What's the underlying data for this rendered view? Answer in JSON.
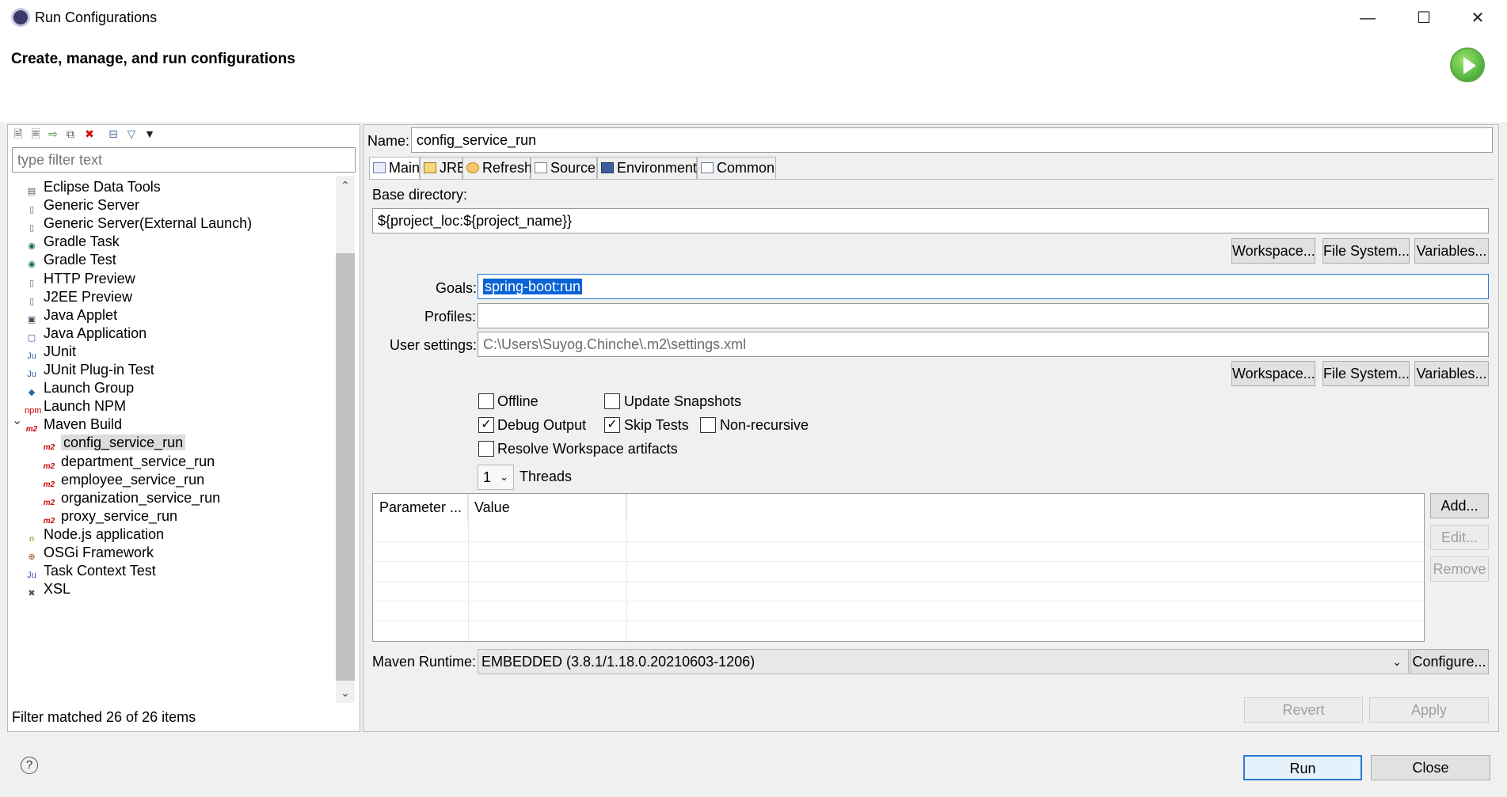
{
  "window": {
    "title": "Run Configurations"
  },
  "header": {
    "title": "Create, manage, and run configurations"
  },
  "left": {
    "filter_placeholder": "type filter text",
    "status": "Filter matched 26 of 26 items",
    "items": [
      {
        "label": "Eclipse Data Tools",
        "icon": "database-icon",
        "level": 0
      },
      {
        "label": "Generic Server",
        "icon": "server-icon",
        "level": 0
      },
      {
        "label": "Generic Server(External Launch)",
        "icon": "server-icon",
        "level": 0
      },
      {
        "label": "Gradle Task",
        "icon": "gradle-icon",
        "level": 0
      },
      {
        "label": "Gradle Test",
        "icon": "gradle-icon",
        "level": 0
      },
      {
        "label": "HTTP Preview",
        "icon": "server-icon",
        "level": 0
      },
      {
        "label": "J2EE Preview",
        "icon": "server-icon",
        "level": 0
      },
      {
        "label": "Java Applet",
        "icon": "applet-icon",
        "level": 0
      },
      {
        "label": "Java Application",
        "icon": "java-app-icon",
        "level": 0
      },
      {
        "label": "JUnit",
        "icon": "junit-icon",
        "level": 0
      },
      {
        "label": "JUnit Plug-in Test",
        "icon": "junit-icon",
        "level": 0
      },
      {
        "label": "Launch Group",
        "icon": "launch-group-icon",
        "level": 0
      },
      {
        "label": "Launch NPM",
        "icon": "npm-icon",
        "level": 0
      },
      {
        "label": "Maven Build",
        "icon": "maven-icon",
        "level": 0,
        "expanded": true
      },
      {
        "label": "config_service_run",
        "icon": "maven-icon",
        "level": 1,
        "selected": true
      },
      {
        "label": "department_service_run",
        "icon": "maven-icon",
        "level": 1
      },
      {
        "label": "employee_service_run",
        "icon": "maven-icon",
        "level": 1
      },
      {
        "label": "organization_service_run",
        "icon": "maven-icon",
        "level": 1
      },
      {
        "label": "proxy_service_run",
        "icon": "maven-icon",
        "level": 1
      },
      {
        "label": "Node.js application",
        "icon": "nodejs-icon",
        "level": 0
      },
      {
        "label": "OSGi Framework",
        "icon": "osgi-icon",
        "level": 0
      },
      {
        "label": "Task Context Test",
        "icon": "junit-icon",
        "level": 0
      },
      {
        "label": "XSL",
        "icon": "xsl-icon",
        "level": 0
      }
    ]
  },
  "config": {
    "name_label": "Name:",
    "name_value": "config_service_run",
    "tabs": [
      "Main",
      "JRE",
      "Refresh",
      "Source",
      "Environment",
      "Common"
    ],
    "base_dir_label": "Base directory:",
    "base_dir_value": "${project_loc:${project_name}}",
    "workspace_btn": "Workspace...",
    "filesystem_btn": "File System...",
    "variables_btn": "Variables...",
    "goals_label": "Goals:",
    "goals_value": "spring-boot:run",
    "profiles_label": "Profiles:",
    "profiles_value": "",
    "user_settings_label": "User settings:",
    "user_settings_value": "C:\\Users\\Suyog.Chinche\\.m2\\settings.xml",
    "offline_label": "Offline",
    "update_snapshots_label": "Update Snapshots",
    "debug_output_label": "Debug Output",
    "skip_tests_label": "Skip Tests",
    "non_recursive_label": "Non-recursive",
    "resolve_workspace_label": "Resolve Workspace artifacts",
    "threads_value": "1",
    "threads_label": "Threads",
    "param_col": "Parameter ...",
    "value_col": "Value",
    "add_btn": "Add...",
    "edit_btn": "Edit...",
    "remove_btn": "Remove",
    "maven_runtime_label": "Maven Runtime:",
    "maven_runtime_value": "EMBEDDED (3.8.1/1.18.0.20210603-1206)",
    "configure_btn": "Configure...",
    "revert_btn": "Revert",
    "apply_btn": "Apply",
    "checks": {
      "offline": false,
      "update_snapshots": false,
      "debug_output": true,
      "skip_tests": true,
      "non_recursive": false,
      "resolve_workspace": false
    }
  },
  "footer": {
    "help": "?",
    "run_btn": "Run",
    "close_btn": "Close"
  }
}
